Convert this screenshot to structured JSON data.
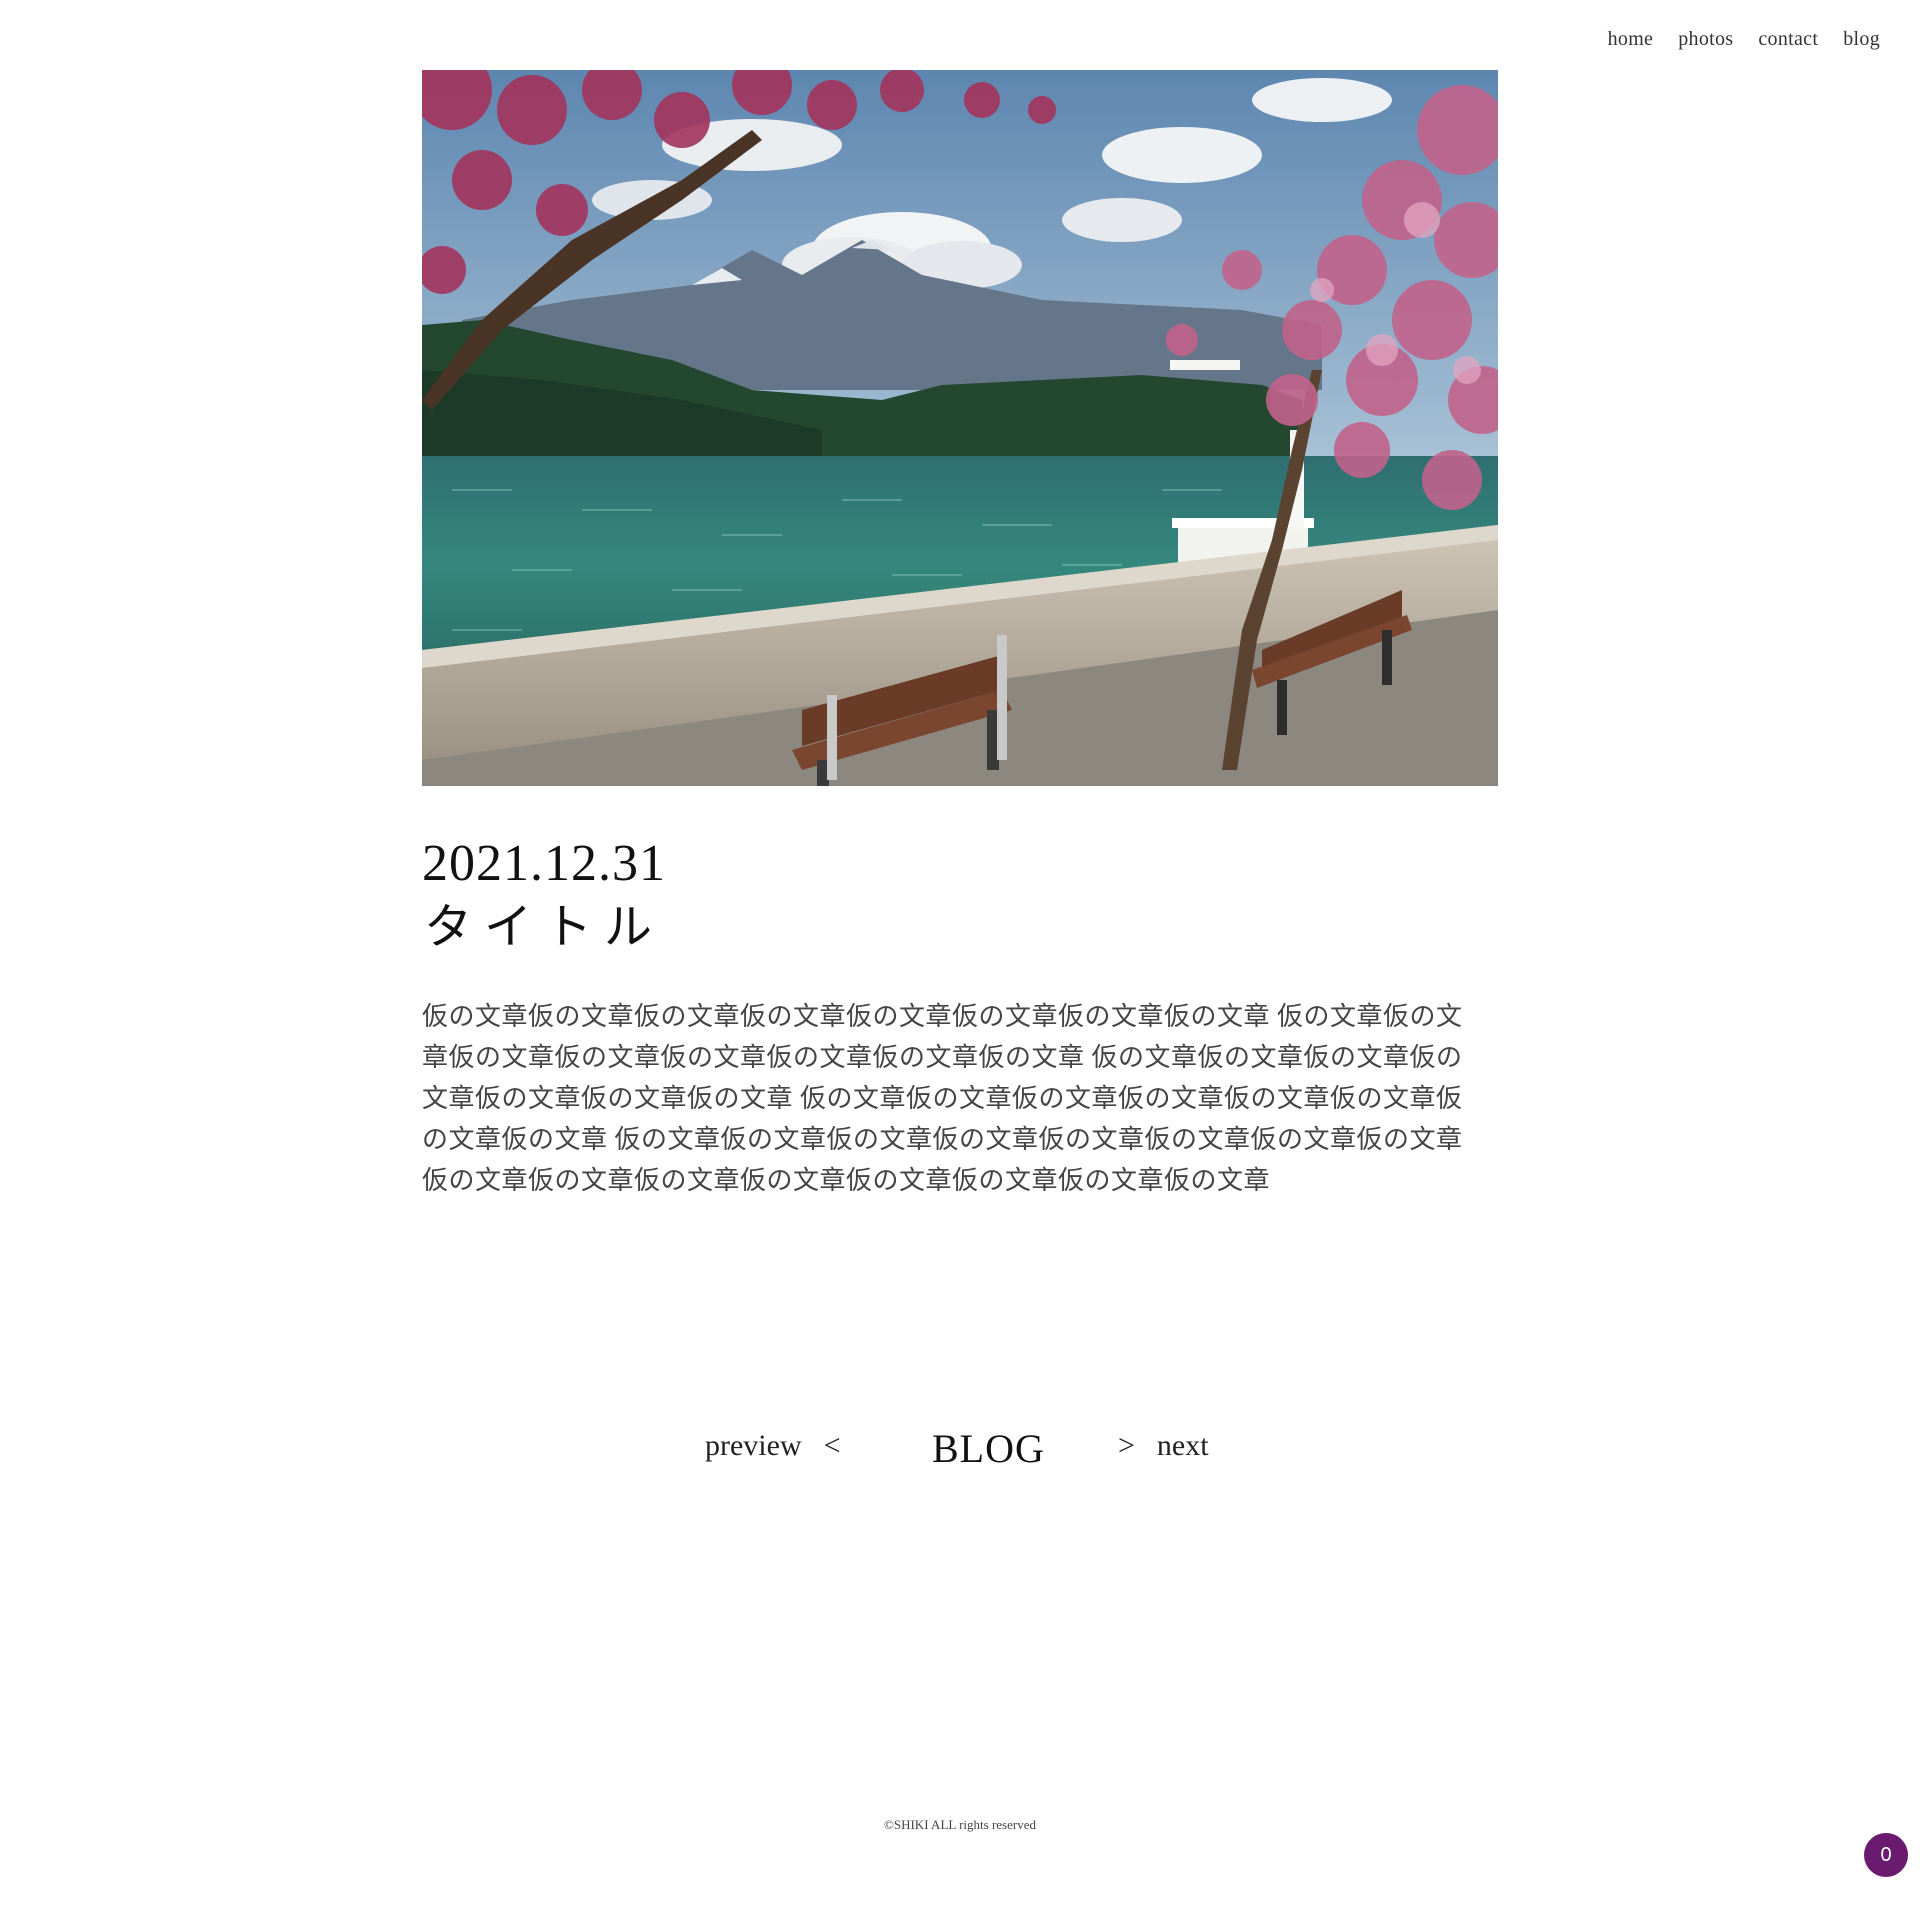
{
  "nav": {
    "items": [
      {
        "label": "home"
      },
      {
        "label": "photos"
      },
      {
        "label": "contact"
      },
      {
        "label": "blog"
      }
    ]
  },
  "post": {
    "date": "2021.12.31",
    "title": "タイトル",
    "body": "仮の文章仮の文章仮の文章仮の文章仮の文章仮の文章仮の文章仮の文章 仮の文章仮の文章仮の文章仮の文章仮の文章仮の文章仮の文章仮の文章 仮の文章仮の文章仮の文章仮の文章仮の文章仮の文章仮の文章 仮の文章仮の文章仮の文章仮の文章仮の文章仮の文章仮の文章仮の文章 仮の文章仮の文章仮の文章仮の文章仮の文章仮の文章仮の文章仮の文章 仮の文章仮の文章仮の文章仮の文章仮の文章仮の文章仮の文章仮の文章"
  },
  "pager": {
    "prev_label": "preview",
    "prev_arrow": "<",
    "center_label": "BLOG",
    "next_arrow": ">",
    "next_label": "next"
  },
  "footer": {
    "copyright": "©SHIKI ALL rights reserved"
  },
  "badge": {
    "count": "0"
  },
  "colors": {
    "badge": "#6b1b6f",
    "text": "#222222"
  }
}
